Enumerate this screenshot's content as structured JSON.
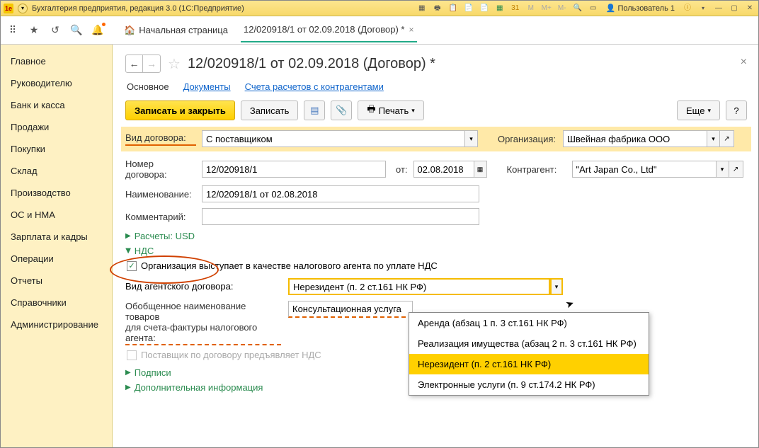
{
  "titlebar": {
    "logo": "1e",
    "title": "Бухгалтерия предприятия, редакция 3.0  (1С:Предприятие)",
    "user": "Пользователь 1"
  },
  "tabs": {
    "home": "Начальная страница",
    "doc": "12/020918/1 от 02.09.2018 (Договор) *"
  },
  "sidebar": {
    "items": [
      "Главное",
      "Руководителю",
      "Банк и касса",
      "Продажи",
      "Покупки",
      "Склад",
      "Производство",
      "ОС и НМА",
      "Зарплата и кадры",
      "Операции",
      "Отчеты",
      "Справочники",
      "Администрирование"
    ]
  },
  "header": {
    "title": "12/020918/1 от 02.09.2018 (Договор) *"
  },
  "subtabs": {
    "main": "Основное",
    "docs": "Документы",
    "accounts": "Счета расчетов с контрагентами"
  },
  "actions": {
    "save_close": "Записать и закрыть",
    "save": "Записать",
    "print": "Печать",
    "more": "Еще"
  },
  "form": {
    "contract_type_lbl": "Вид договора:",
    "contract_type_val": "С поставщиком",
    "org_lbl": "Организация:",
    "org_val": "Швейная фабрика ООО",
    "num_lbl": "Номер договора:",
    "num_val": "12/020918/1",
    "from_lbl": "от:",
    "from_val": "02.08.2018",
    "counter_lbl": "Контрагент:",
    "counter_val": "\"Art Japan Co., Ltd\"",
    "name_lbl": "Наименование:",
    "name_val": "12/020918/1 от 02.08.2018",
    "comment_lbl": "Комментарий:",
    "comment_val": ""
  },
  "expanders": {
    "calc": "Расчеты: USD",
    "nds": "НДС",
    "sign": "Подписи",
    "addinfo": "Дополнительная информация"
  },
  "nds": {
    "agent_checkbox": "Организация выступает в качестве налогового агента по уплате НДС",
    "agent_type_lbl": "Вид агентского договора:",
    "agent_type_val": "Нерезидент (п. 2 ст.161 НК РФ)",
    "goods_lbl1": "Обобщенное наименование товаров",
    "goods_lbl2": "для счета-фактуры налогового агента:",
    "goods_val": "Консультационная услуга",
    "supplier_nds": "Поставщик по договору предъявляет НДС",
    "options": [
      "Аренда (абзац 1 п. 3 ст.161 НК РФ)",
      "Реализация имущества (абзац 2 п. 3 ст.161 НК РФ)",
      "Нерезидент (п. 2 ст.161 НК РФ)",
      "Электронные услуги (п. 9 ст.174.2 НК РФ)"
    ]
  }
}
